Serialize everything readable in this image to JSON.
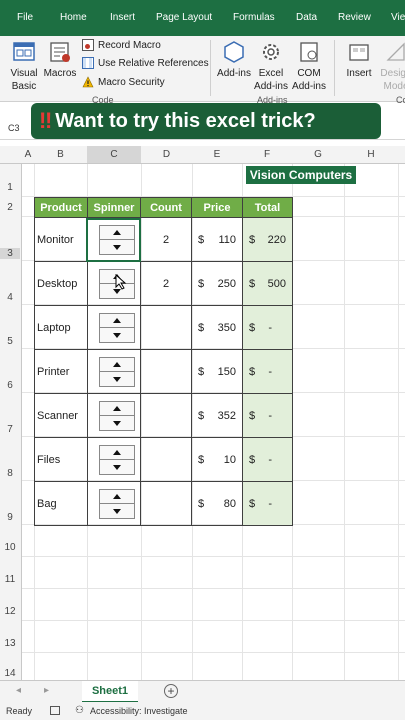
{
  "menu": {
    "file": "File",
    "home": "Home",
    "insert": "Insert",
    "page_layout": "Page Layout",
    "formulas": "Formulas",
    "data": "Data",
    "review": "Review",
    "view": "View"
  },
  "ribbon": {
    "visual_basic": "Visual Basic",
    "macros": "Macros",
    "record_macro": "Record Macro",
    "relative_refs": "Use Relative References",
    "macro_security": "Macro Security",
    "group_code": "Code",
    "addins": "Add-ins",
    "excel_addins": "Excel Add-ins",
    "com_addins": "COM Add-ins",
    "group_addins": "Add-ins",
    "insert": "Insert",
    "design_mode": "Design Mode",
    "group_controls": "Co"
  },
  "banner": {
    "bang": "‼",
    "text": "Want to try this excel trick?"
  },
  "namebox": "C3",
  "columns": [
    "A",
    "B",
    "C",
    "D",
    "E",
    "F",
    "G",
    "H"
  ],
  "rows": [
    "1",
    "2",
    "3",
    "4",
    "5",
    "6",
    "7",
    "8",
    "9",
    "10",
    "11",
    "12",
    "13",
    "14"
  ],
  "company": "Vision Computers",
  "table": {
    "headers": [
      "Product",
      "Spinner",
      "Count",
      "Price",
      "Total"
    ],
    "rows": [
      {
        "product": "Monitor",
        "count": "2",
        "cur": "$",
        "price": "110",
        "tcur": "$",
        "total": "220"
      },
      {
        "product": "Desktop",
        "count": "2",
        "cur": "$",
        "price": "250",
        "tcur": "$",
        "total": "500"
      },
      {
        "product": "Laptop",
        "count": "",
        "cur": "$",
        "price": "350",
        "tcur": "$",
        "total": "-"
      },
      {
        "product": "Printer",
        "count": "",
        "cur": "$",
        "price": "150",
        "tcur": "$",
        "total": "-"
      },
      {
        "product": "Scanner",
        "count": "",
        "cur": "$",
        "price": "352",
        "tcur": "$",
        "total": "-"
      },
      {
        "product": "Files",
        "count": "",
        "cur": "$",
        "price": "10",
        "tcur": "$",
        "total": "-"
      },
      {
        "product": "Bag",
        "count": "",
        "cur": "$",
        "price": "80",
        "tcur": "$",
        "total": "-"
      }
    ]
  },
  "sheet_tab": "Sheet1",
  "add_sheet": "+",
  "status": {
    "ready": "Ready",
    "accessibility": "Accessibility: Investigate"
  }
}
